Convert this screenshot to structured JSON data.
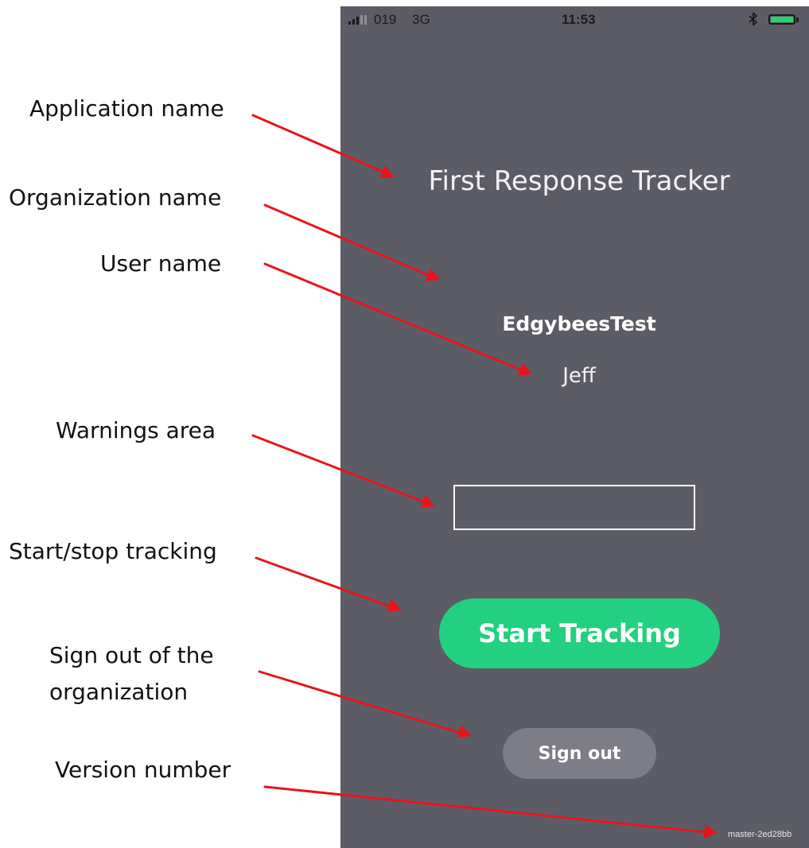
{
  "annotations": {
    "application_name": "Application name",
    "organization_name": "Organization name",
    "user_name": "User name",
    "warnings_area": "Warnings area",
    "start_stop_tracking": "Start/stop tracking",
    "sign_out_line1": "Sign out of the",
    "sign_out_line2": "organization",
    "version_number": "Version number"
  },
  "status_bar": {
    "carrier": "019",
    "network": "3G",
    "time": "11:53",
    "bluetooth_icon": "bluetooth-icon",
    "battery_icon": "battery-icon",
    "battery_color": "#27d36a"
  },
  "app": {
    "title": "First Response Tracker",
    "organization": "EdgybeesTest",
    "user": "Jeff",
    "warnings": "",
    "start_button_label": "Start Tracking",
    "sign_out_label": "Sign out",
    "version": "master-2ed28bb"
  },
  "colors": {
    "screen_background": "#5b5c66",
    "start_button": "#23d07f",
    "sign_out_button": "#7c7d87",
    "arrow": "#e8141b"
  }
}
